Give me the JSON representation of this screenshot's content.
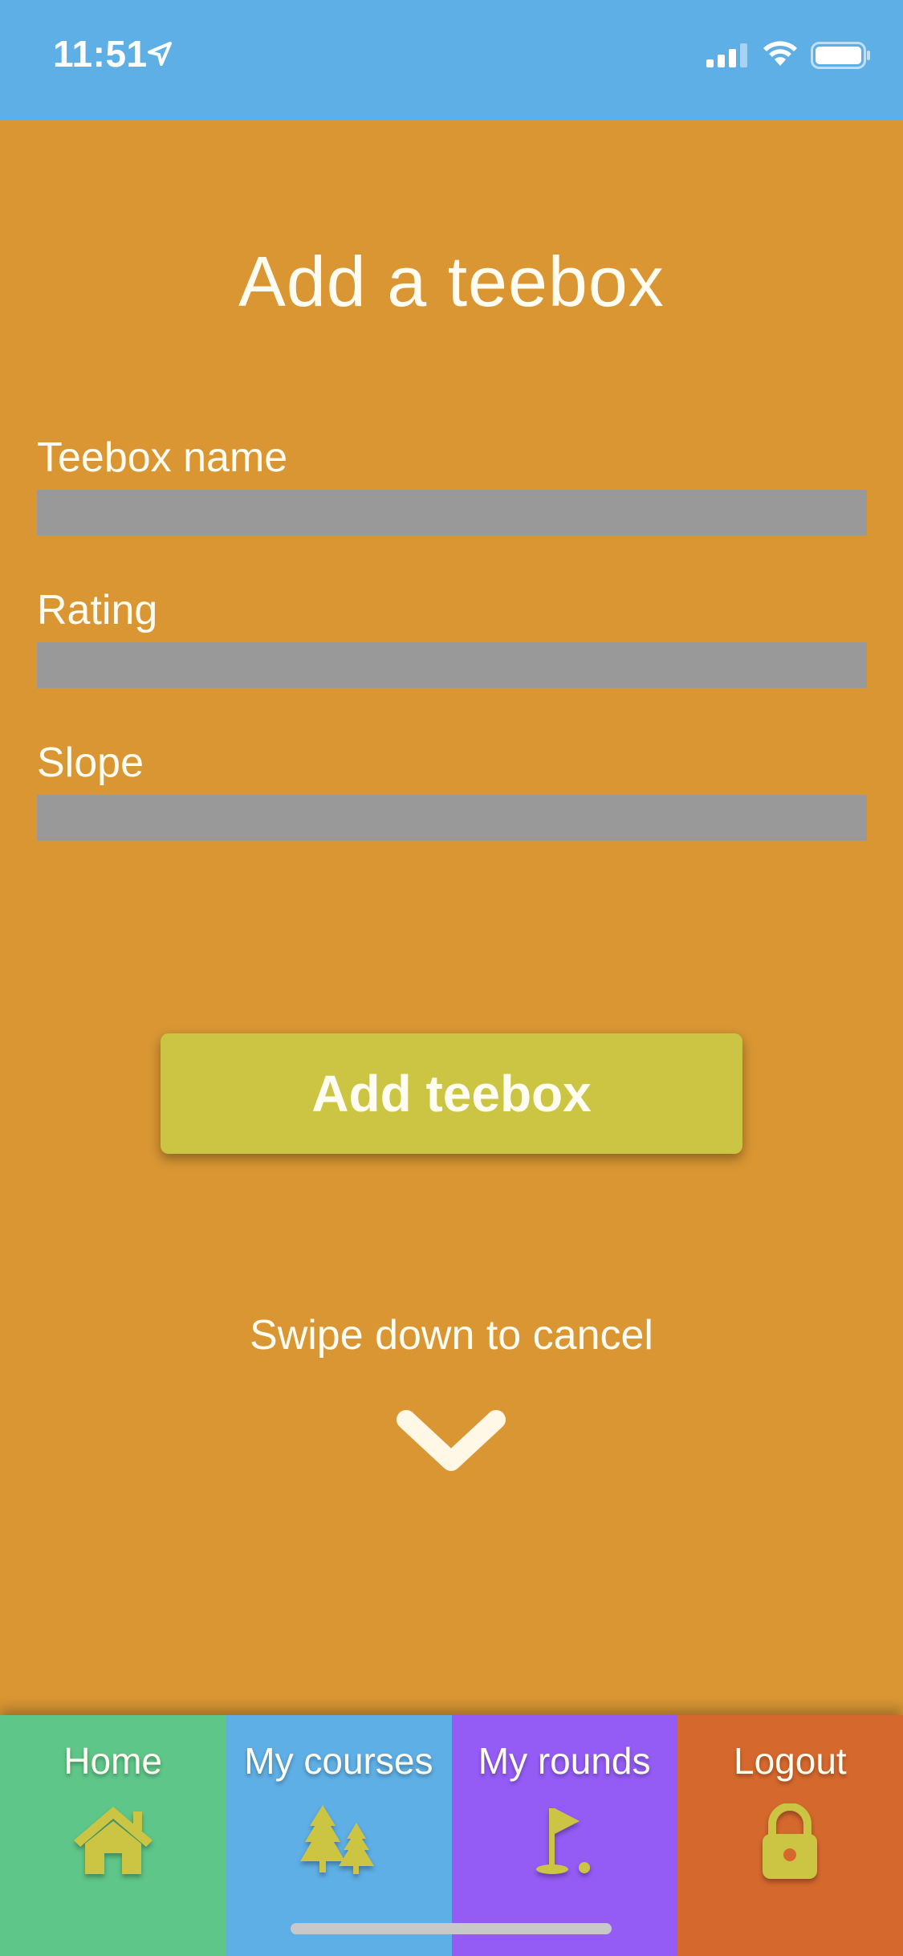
{
  "status_bar": {
    "time": "11:51"
  },
  "page": {
    "title": "Add a teebox"
  },
  "form": {
    "fields": [
      {
        "label": "Teebox name",
        "value": "",
        "placeholder": ""
      },
      {
        "label": "Rating",
        "value": "",
        "placeholder": ""
      },
      {
        "label": "Slope",
        "value": "",
        "placeholder": ""
      }
    ],
    "submit_label": "Add teebox"
  },
  "cancel_hint": "Swipe down to cancel",
  "tabbar": {
    "tabs": [
      {
        "label": "Home",
        "icon": "home-icon",
        "color": "#5EC689"
      },
      {
        "label": "My courses",
        "icon": "trees-icon",
        "color": "#5EAFE5"
      },
      {
        "label": "My rounds",
        "icon": "golf-flag-icon",
        "color": "#945CF5"
      },
      {
        "label": "Logout",
        "icon": "lock-icon",
        "color": "#D5682D"
      }
    ]
  },
  "colors": {
    "status_bar": "#5EAFE5",
    "background": "#D99633",
    "button": "#CCC544",
    "input": "#999999",
    "icon": "#CCC544"
  }
}
